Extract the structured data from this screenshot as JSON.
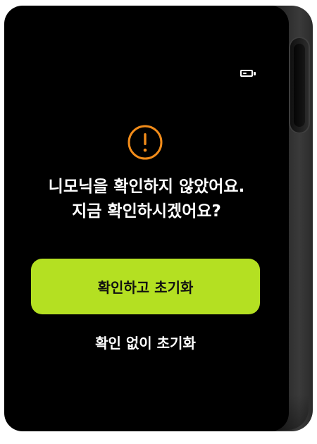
{
  "status_bar": {
    "battery_icon": "battery-icon",
    "battery_level": 0.5
  },
  "dialog": {
    "icon": "exclamation-circle-icon",
    "icon_color": "#f28c1a",
    "message_lines": [
      "니모닉을 확인하지 않았어요.",
      "지금 확인하시겠어요?"
    ],
    "primary_button_label": "확인하고 초기화",
    "primary_button_color": "#b4e022",
    "secondary_button_label": "확인 없이 초기화"
  },
  "device": {
    "side_button_icon": "side-button"
  }
}
